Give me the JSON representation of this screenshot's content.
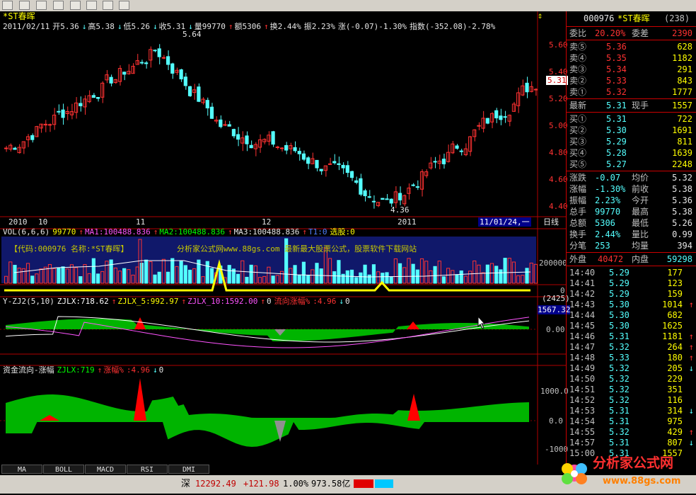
{
  "stock": {
    "header_name": "*ST春晖",
    "info_line": [
      "2011/02/11",
      "开5.36",
      "↓",
      "高5.38",
      "↓",
      "低5.26",
      "↓",
      "收5.31",
      "↓",
      "量99770",
      "↑",
      "额5306",
      "↑",
      "换2.44%",
      "振2.23%",
      "涨(-0.07)-1.30%",
      "指数(-352.08)-2.78%"
    ],
    "high_label": "5.64",
    "low_label": "4.36",
    "price_tag": "5.31",
    "price_ticks": [
      "5.60",
      "5.40",
      "5.20",
      "5.00",
      "4.80",
      "4.60",
      "4.40"
    ],
    "date_labels": [
      "2010",
      "10",
      "11",
      "12",
      "2011"
    ],
    "cursor_date": "11/01/24,一",
    "period": "日线"
  },
  "vol_panel": {
    "title_parts": [
      "VOL(6,6,6)",
      "99770",
      "↑",
      "MA1:100488.836",
      "↑",
      "MA2:100488.836",
      "↑",
      "MA3:100488.836",
      "↑",
      "T1:0",
      "选股:0"
    ],
    "watermark_code": "【代码:000976  名称:*ST春晖】",
    "watermark_site": "分析家公式网www.88gs.com  最新最大股票公式，股票软件下载网站",
    "ticks": [
      "200000",
      "0"
    ]
  },
  "ind1_panel": {
    "title_parts": [
      "Y-ZJ2(5,10)",
      "ZJLX:718.62",
      "↑",
      "ZJLX_5:992.97",
      "↑",
      "ZJLX_10:1592.00",
      "↑",
      "0",
      "流向涨幅%",
      ":4.96",
      "↓",
      "0"
    ],
    "ticks": [
      "(2425)",
      "1567.32",
      "0.00"
    ]
  },
  "ind2_panel": {
    "title_parts": [
      "资金流向-涨幅",
      "ZJLX:719",
      "↑",
      "涨幅%",
      ":4.96",
      "↓",
      "0"
    ],
    "ticks": [
      "1000.0",
      "0.0",
      "-1000"
    ]
  },
  "quote": {
    "code": "000976",
    "name": "*ST春晖",
    "extra": "(238)",
    "weibi": {
      "label": "委比",
      "value": "20.20%",
      "label2": "委差",
      "value2": "2390"
    },
    "sells": [
      {
        "label": "卖⑤",
        "price": "5.36",
        "vol": "628"
      },
      {
        "label": "卖④",
        "price": "5.35",
        "vol": "1182"
      },
      {
        "label": "卖③",
        "price": "5.34",
        "vol": "291"
      },
      {
        "label": "卖②",
        "price": "5.33",
        "vol": "843"
      },
      {
        "label": "卖①",
        "price": "5.32",
        "vol": "1777"
      }
    ],
    "latest": {
      "label": "最新",
      "price": "5.31",
      "label2": "现手",
      "vol": "1557"
    },
    "buys": [
      {
        "label": "买①",
        "price": "5.31",
        "vol": "722"
      },
      {
        "label": "买②",
        "price": "5.30",
        "vol": "1691"
      },
      {
        "label": "买③",
        "price": "5.29",
        "vol": "811"
      },
      {
        "label": "买④",
        "price": "5.28",
        "vol": "1639"
      },
      {
        "label": "买⑤",
        "price": "5.27",
        "vol": "2248"
      }
    ],
    "stats": [
      {
        "l1": "涨跌",
        "v1": "-0.07",
        "l2": "均价",
        "v2": "5.32"
      },
      {
        "l1": "涨幅",
        "v1": "-1.30%",
        "l2": "前收",
        "v2": "5.38"
      },
      {
        "l1": "振幅",
        "v1": "2.23%",
        "l2": "今开",
        "v2": "5.36"
      },
      {
        "l1": "总手",
        "v1": "99770",
        "l2": "最高",
        "v2": "5.38"
      },
      {
        "l1": "总额",
        "v1": "5306",
        "l2": "最低",
        "v2": "5.26"
      },
      {
        "l1": "换手",
        "v1": "2.44%",
        "l2": "量比",
        "v2": "0.99"
      },
      {
        "l1": "分笔",
        "v1": "253",
        "l2": "均量",
        "v2": "394"
      }
    ],
    "outer": {
      "label": "外盘",
      "value": "40472",
      "label2": "内盘",
      "value2": "59298"
    },
    "ticks": [
      {
        "t": "14:40",
        "p": "5.29",
        "v": "177",
        "d": ""
      },
      {
        "t": "14:41",
        "p": "5.29",
        "v": "123",
        "d": ""
      },
      {
        "t": "14:42",
        "p": "5.29",
        "v": "159",
        "d": ""
      },
      {
        "t": "14:43",
        "p": "5.30",
        "v": "1014",
        "d": "↑"
      },
      {
        "t": "14:44",
        "p": "5.30",
        "v": "682",
        "d": ""
      },
      {
        "t": "14:45",
        "p": "5.30",
        "v": "1625",
        "d": ""
      },
      {
        "t": "14:46",
        "p": "5.31",
        "v": "1181",
        "d": "↑"
      },
      {
        "t": "14:47",
        "p": "5.32",
        "v": "264",
        "d": "↑"
      },
      {
        "t": "14:48",
        "p": "5.33",
        "v": "180",
        "d": "↑"
      },
      {
        "t": "14:49",
        "p": "5.32",
        "v": "205",
        "d": "↓"
      },
      {
        "t": "14:50",
        "p": "5.32",
        "v": "229",
        "d": ""
      },
      {
        "t": "14:51",
        "p": "5.32",
        "v": "351",
        "d": ""
      },
      {
        "t": "14:52",
        "p": "5.32",
        "v": "116",
        "d": ""
      },
      {
        "t": "14:53",
        "p": "5.31",
        "v": "314",
        "d": "↓"
      },
      {
        "t": "14:54",
        "p": "5.31",
        "v": "975",
        "d": ""
      },
      {
        "t": "14:55",
        "p": "5.32",
        "v": "429",
        "d": "↑"
      },
      {
        "t": "14:57",
        "p": "5.31",
        "v": "807",
        "d": "↓"
      },
      {
        "t": "15:00",
        "p": "5.31",
        "v": "1557",
        "d": ""
      }
    ]
  },
  "tabs": [
    "MA",
    "BOLL",
    "MACD",
    "RSI",
    "DMI"
  ],
  "status": {
    "market": "深",
    "index": "12292.49",
    "change": "+121.98",
    "pct": "1.00%",
    "amount": "973.58亿"
  },
  "logo": {
    "text": "分析家公式网",
    "url": "www.88gs.com"
  },
  "colors": {
    "up": "#ff3232",
    "down": "#54ffff",
    "ma_white": "#ffffff",
    "ma_yellow": "#ffff00",
    "ma_magenta": "#ff54ff",
    "flow_green": "#00b400",
    "flow_red": "#ff0000"
  }
}
